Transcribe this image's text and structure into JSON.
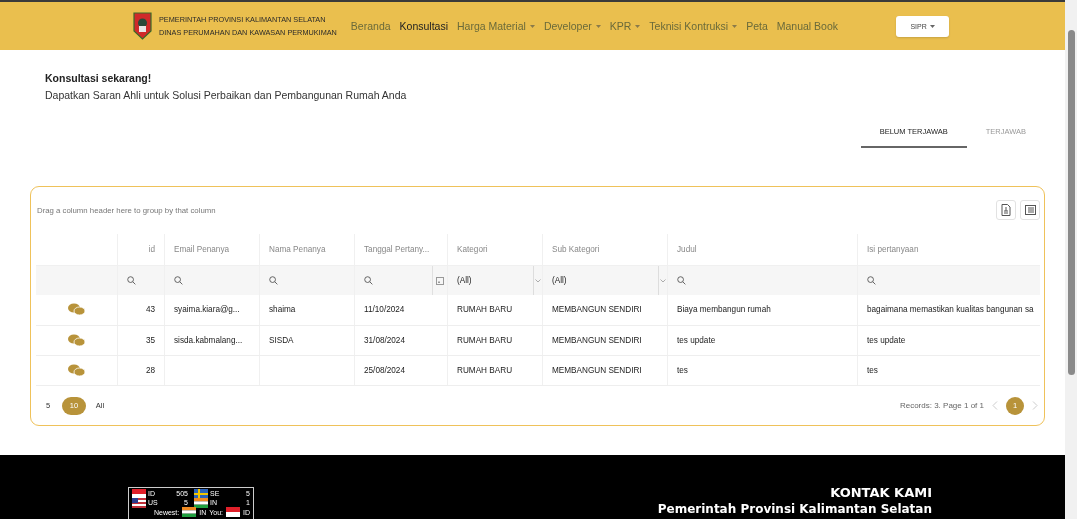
{
  "header": {
    "agency_line_1": "PEMERINTAH PROVINSI KALIMANTAN SELATAN",
    "agency_line_2": "DINAS PERUMAHAN DAN KAWASAN PERMUKIMAN",
    "nav": [
      {
        "label": "Beranda",
        "selected": false,
        "dropdown": false
      },
      {
        "label": "Konsultasi",
        "selected": true,
        "dropdown": false
      },
      {
        "label": "Harga Material",
        "selected": false,
        "dropdown": true
      },
      {
        "label": "Developer",
        "selected": false,
        "dropdown": true
      },
      {
        "label": "KPR",
        "selected": false,
        "dropdown": true
      },
      {
        "label": "Teknisi Kontruksi",
        "selected": false,
        "dropdown": true
      },
      {
        "label": "Peta",
        "selected": false,
        "dropdown": false
      },
      {
        "label": "Manual Book",
        "selected": false,
        "dropdown": false
      }
    ],
    "app_button": "SIPR"
  },
  "intro": {
    "title": "Konsultasi sekarang!",
    "subtitle": "Dapatkan Saran Ahli untuk Solusi Perbaikan dan Pembangunan Rumah Anda"
  },
  "tabs": [
    {
      "label": "BELUM TERJAWAB",
      "selected": true
    },
    {
      "label": "TERJAWAB",
      "selected": false
    }
  ],
  "grid": {
    "group_hint": "Drag a column header here to group by that column",
    "columns": [
      {
        "kind": "action"
      },
      {
        "label": "id",
        "kind": "number"
      },
      {
        "label": "Email Penanya",
        "kind": "text"
      },
      {
        "label": "Nama Penanya",
        "kind": "text"
      },
      {
        "label": "Tanggal Pertany...",
        "kind": "date"
      },
      {
        "label": "Kategori",
        "kind": "select",
        "filter_value": "(All)"
      },
      {
        "label": "Sub Kategori",
        "kind": "select",
        "filter_value": "(All)"
      },
      {
        "label": "Judul",
        "kind": "text"
      },
      {
        "label": "Isi pertanyaan",
        "kind": "text"
      }
    ],
    "rows": [
      {
        "cells": [
          "",
          "43",
          "syaima.kiara@g...",
          "shaima",
          "11/10/2024",
          "RUMAH BARU",
          "MEMBANGUN SENDIRI",
          "Biaya membangun rumah",
          "bagaimana memastikan kualitas bangunan sa"
        ]
      },
      {
        "cells": [
          "",
          "35",
          "sisda.kabmalang...",
          "SISDA",
          "31/08/2024",
          "RUMAH BARU",
          "MEMBANGUN SENDIRI",
          "tes update",
          "tes update"
        ]
      },
      {
        "cells": [
          "",
          "28",
          "",
          "",
          "25/08/2024",
          "RUMAH BARU",
          "MEMBANGUN SENDIRI",
          "tes",
          "tes"
        ]
      }
    ],
    "page_sizes": [
      {
        "label": "5",
        "selected": false
      },
      {
        "label": "10",
        "selected": true
      },
      {
        "label": "All",
        "selected": false
      }
    ],
    "records_info": "Records: 3. Page 1 of 1",
    "pages": [
      {
        "label": "1",
        "selected": true
      }
    ]
  },
  "footer": {
    "visitor_counter": [
      {
        "code": "ID",
        "count": "505",
        "kind": "id"
      },
      {
        "code": "SE",
        "count": "5",
        "kind": "se"
      },
      {
        "code": "US",
        "count": "5",
        "kind": "us"
      },
      {
        "code": "IN",
        "count": "1",
        "kind": "in"
      }
    ],
    "recent_visitors": [
      {
        "label": "Newest:",
        "code": "IN",
        "kind": "in"
      },
      {
        "label": "You:",
        "code": "ID",
        "kind": "id"
      }
    ],
    "contact_title": "KONTAK KAMI",
    "contact_line": "Pemerintah Provinsi Kalimantan Selatan"
  }
}
